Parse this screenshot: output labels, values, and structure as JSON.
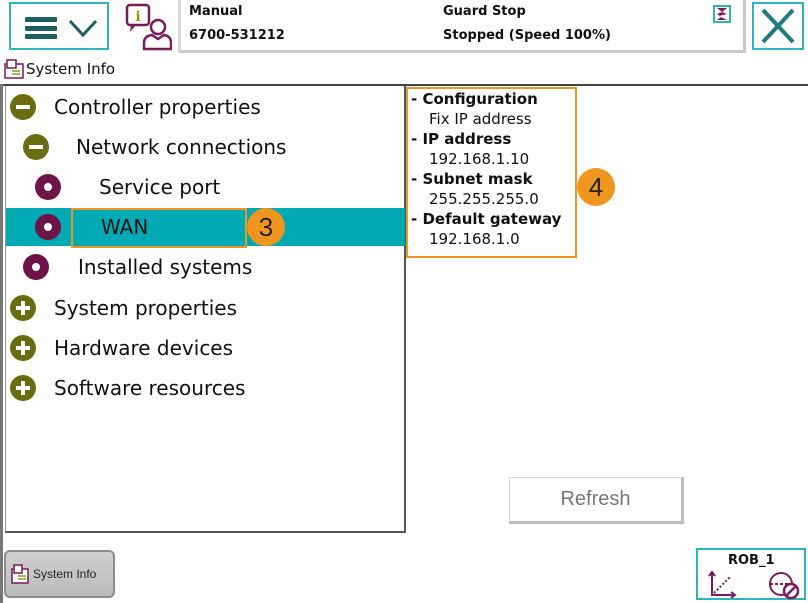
{
  "header": {
    "menu_icon": "hamburger-menu-icon",
    "info_icon": "info-user-icon",
    "status": {
      "mode": "Manual",
      "controller_id": "6700-531212",
      "state": "Guard Stop",
      "speed_status": "Stopped (Speed 100%)"
    },
    "task_icon": "task-status-icon",
    "close_icon": "close-x-icon"
  },
  "title": {
    "label": "System Info",
    "icon": "system-info-icon"
  },
  "tree": {
    "nodes": [
      {
        "label": "Controller properties",
        "icon": "collapse-icon",
        "level": 0,
        "expanded": true
      },
      {
        "label": "Network connections",
        "icon": "collapse-icon",
        "level": 1,
        "expanded": true
      },
      {
        "label": "Service port",
        "icon": "leaf-icon",
        "level": 2
      },
      {
        "label": "WAN",
        "icon": "leaf-icon",
        "level": 2,
        "selected": true
      },
      {
        "label": "Installed systems",
        "icon": "leaf-icon",
        "level": 1
      },
      {
        "label": "System properties",
        "icon": "expand-icon",
        "level": 0
      },
      {
        "label": "Hardware devices",
        "icon": "expand-icon",
        "level": 0
      },
      {
        "label": "Software resources",
        "icon": "expand-icon",
        "level": 0
      }
    ]
  },
  "details": {
    "lines": [
      {
        "text": "- Configuration",
        "kind": "header"
      },
      {
        "text": "Fix IP address",
        "kind": "value"
      },
      {
        "text": "- IP address",
        "kind": "header"
      },
      {
        "text": "192.168.1.10",
        "kind": "value"
      },
      {
        "text": "- Subnet mask",
        "kind": "header"
      },
      {
        "text": "255.255.255.0",
        "kind": "value"
      },
      {
        "text": "- Default gateway",
        "kind": "header"
      },
      {
        "text": "192.168.1.0",
        "kind": "value"
      }
    ]
  },
  "annotations": {
    "badge_3": "3",
    "badge_4": "4"
  },
  "actions": {
    "refresh_label": "Refresh"
  },
  "taskbar": {
    "system_info_label": "System Info"
  },
  "quickset": {
    "mechanical_unit": "ROB_1"
  },
  "colors": {
    "accent_teal": "#00aab4",
    "border_teal": "#2db5bd",
    "callout_orange": "#f0961e",
    "tree_olive": "#6b6b10",
    "tree_maroon": "#6e1448"
  }
}
